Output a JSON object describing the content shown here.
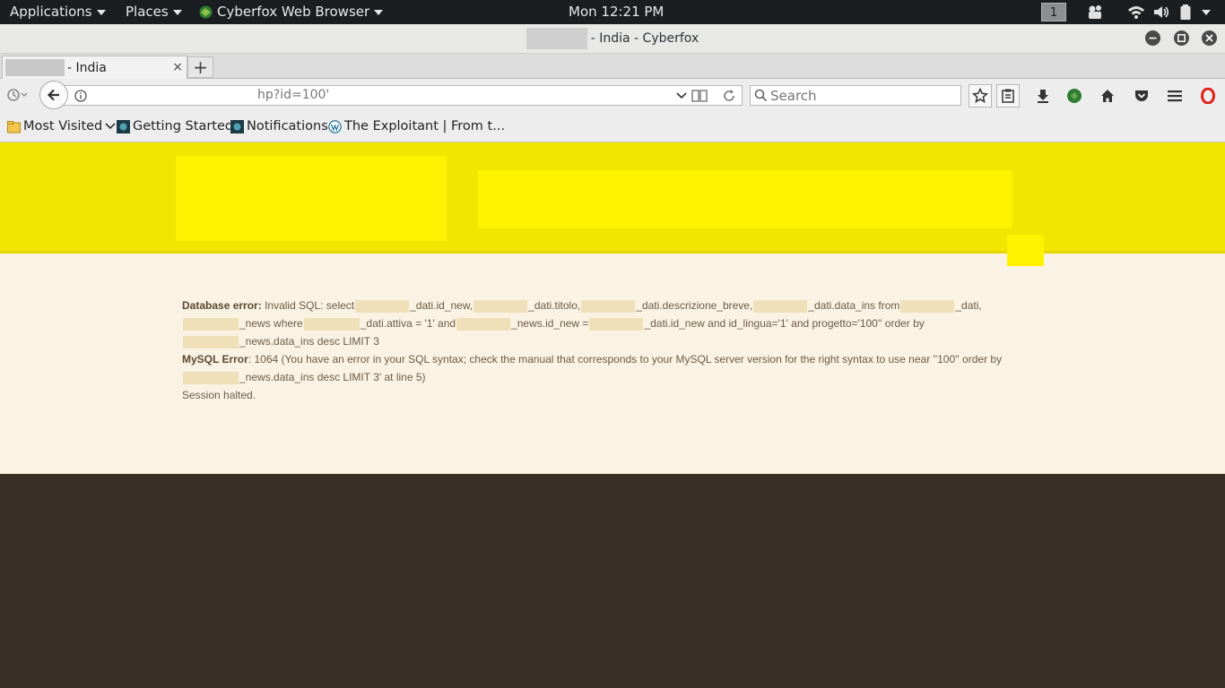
{
  "topbar": {
    "applications": "Applications",
    "places": "Places",
    "app_name": "Cyberfox Web Browser",
    "clock": "Mon 12:21 PM",
    "workspace": "1"
  },
  "window": {
    "title": "- India - Cyberfox"
  },
  "tabs": [
    {
      "label": "- India",
      "close": "×"
    }
  ],
  "newtab_label": "+",
  "url": {
    "value": "hp?id=100'"
  },
  "search": {
    "placeholder": "Search"
  },
  "bookmarks": [
    {
      "label": "Most Visited"
    },
    {
      "label": "Getting Started"
    },
    {
      "label": "Notifications"
    },
    {
      "label": "The Exploitant | From t..."
    }
  ],
  "error": {
    "db_label": "Database error:",
    "sql_1": "Invalid SQL: select",
    "sql_2": "_dati.id_new,",
    "sql_3": "_dati.titolo,",
    "sql_4": "_dati.descrizione_breve,",
    "sql_5": "_dati.data_ins from",
    "sql_6": "_dati,",
    "sql_7": "_news where",
    "sql_8": "_dati.attiva = '1' and",
    "sql_9": "_news.id_new =",
    "sql_10": "_dati.id_new and id_lingua='1' and progetto='100'' order by",
    "sql_11": "_news.data_ins desc LIMIT 3",
    "mysql_label": "MySQL Error",
    "mysql_1": ": 1064 (You have an error in your SQL syntax; check the manual that corresponds to your MySQL server version for the right syntax to use near ''100'' order by",
    "mysql_2": "_news.data_ins desc LIMIT 3' at line 5)",
    "halted": "Session halted."
  },
  "colors": {
    "header_yellow": "#f2e600",
    "block_yellow": "#fff200",
    "page_bg": "#faf3e4",
    "below_page": "#3a2f27"
  }
}
